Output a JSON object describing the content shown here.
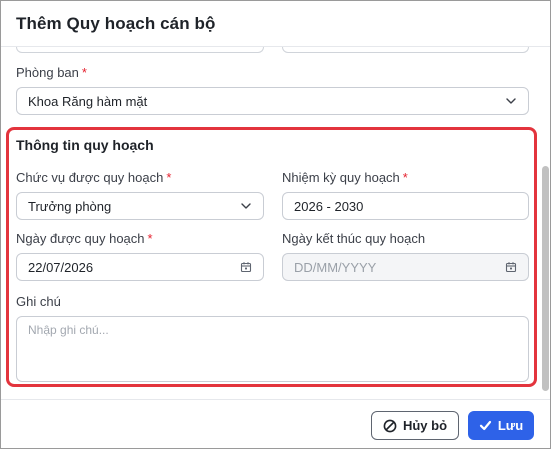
{
  "dialog": {
    "title": "Thêm Quy hoạch cán bộ"
  },
  "department": {
    "label": "Phòng ban",
    "required_mark": "*",
    "value": "Khoa Răng hàm mặt"
  },
  "section": {
    "title": "Thông tin quy hoạch"
  },
  "position": {
    "label": "Chức vụ được quy hoạch",
    "required_mark": "*",
    "value": "Trưởng phòng"
  },
  "term": {
    "label": "Nhiệm kỳ quy hoạch",
    "required_mark": "*",
    "value": "2026 - 2030"
  },
  "plan_date": {
    "label": "Ngày được quy hoạch",
    "required_mark": "*",
    "value": "22/07/2026"
  },
  "end_date": {
    "label": "Ngày kết thúc quy hoạch",
    "placeholder": "DD/MM/YYYY"
  },
  "note": {
    "label": "Ghi chú",
    "placeholder": "Nhập ghi chú..."
  },
  "footer": {
    "cancel_label": "Hủy bỏ",
    "save_label": "Lưu"
  },
  "colors": {
    "accent": "#2e62e8",
    "highlight_border": "#e3343d",
    "required": "#e5212e"
  }
}
